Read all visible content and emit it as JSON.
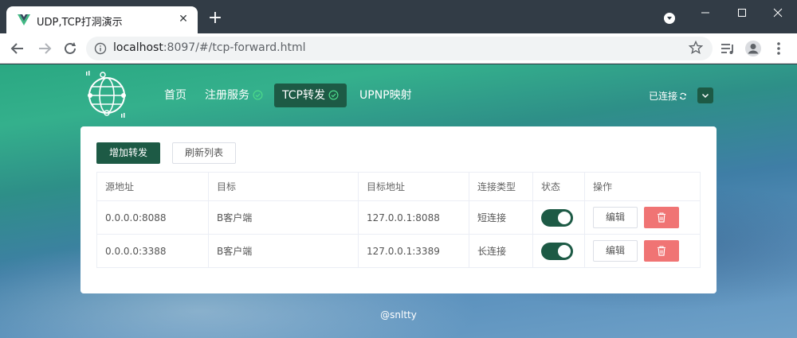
{
  "browser": {
    "tab_title": "UDP,TCP打洞演示",
    "url_host": "localhost",
    "url_rest": ":8097/#/tcp-forward.html",
    "tab_close_icon": "close-icon",
    "new_tab_icon": "plus-icon"
  },
  "header": {
    "nav": [
      {
        "label": "首页",
        "check": false,
        "active": false
      },
      {
        "label": "注册服务",
        "check": true,
        "active": false
      },
      {
        "label": "TCP转发",
        "check": true,
        "active": true
      },
      {
        "label": "UPNP映射",
        "check": false,
        "active": false
      }
    ],
    "connection_status": "已连接"
  },
  "actions": {
    "add_label": "增加转发",
    "refresh_label": "刷新列表"
  },
  "table": {
    "columns": [
      "源地址",
      "目标",
      "目标地址",
      "连接类型",
      "状态",
      "操作"
    ],
    "rows": [
      {
        "source": "0.0.0.0:8088",
        "target": "B客户端",
        "target_addr": "127.0.0.1:8088",
        "conn_type": "短连接",
        "enabled": true,
        "edit_label": "编辑"
      },
      {
        "source": "0.0.0.0:3388",
        "target": "B客户端",
        "target_addr": "127.0.0.1:3389",
        "conn_type": "长连接",
        "enabled": true,
        "edit_label": "编辑"
      }
    ]
  },
  "footer": {
    "text": "@snltty"
  },
  "colors": {
    "accent": "#1d5a45",
    "danger": "#f07474",
    "check": "#4cd98a"
  }
}
